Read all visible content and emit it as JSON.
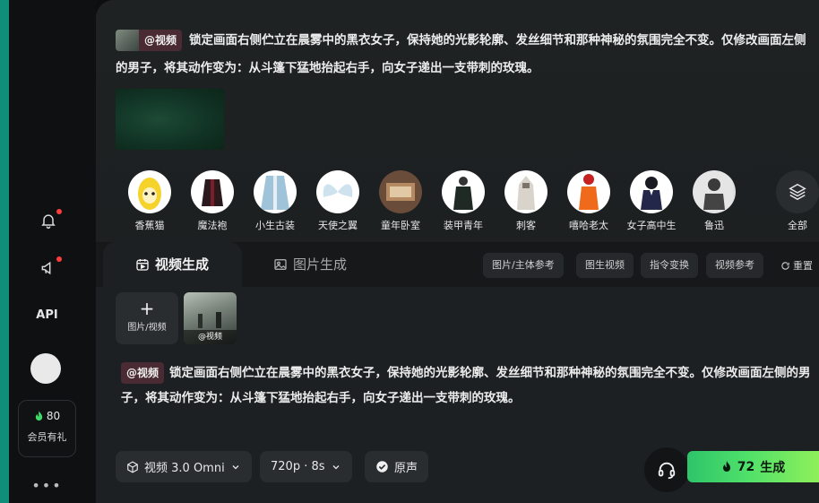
{
  "sidebar": {
    "api_label": "API",
    "vip_count": "80",
    "vip_label": "会员有礼",
    "more": "•••"
  },
  "message": {
    "tag": "@视频",
    "text_line1": "锁定画面右侧伫立在晨雾中的黑衣女子，保持她的光影轮廓、发丝细节和那种神秘的氛围完全不变。仅修改画面左侧的男子，将其动作变为：从斗篷下猛地抬起右手，向女子递出一支带刺的玫瑰。"
  },
  "templates": [
    {
      "name": "香蕉猫",
      "icon": "banana-cat-avatar"
    },
    {
      "name": "魔法袍",
      "icon": "magic-robe-avatar"
    },
    {
      "name": "小生古装",
      "icon": "ancient-costume-avatar"
    },
    {
      "name": "天使之翼",
      "icon": "angel-wings-avatar"
    },
    {
      "name": "童年卧室",
      "icon": "childhood-room-avatar"
    },
    {
      "name": "装甲青年",
      "icon": "armored-youth-avatar"
    },
    {
      "name": "刺客",
      "icon": "assassin-avatar"
    },
    {
      "name": "嘻哈老太",
      "icon": "hiphop-granny-avatar"
    },
    {
      "name": "女子高中生",
      "icon": "schoolgirl-avatar"
    },
    {
      "name": "鲁迅",
      "icon": "luxun-avatar"
    }
  ],
  "all_label": "全部",
  "composer": {
    "tabs": [
      {
        "label": "视频生成",
        "icon": "video-calendar-icon"
      },
      {
        "label": "图片生成",
        "icon": "image-icon"
      }
    ],
    "chips": [
      "图片/主体参考",
      "图生视频",
      "指令变换",
      "视频参考"
    ],
    "reset_label": "重置",
    "upload_label": "图片/视频",
    "upload_plus": "+",
    "ref_caption": "@视频",
    "prompt_tag": "@视频",
    "prompt_text": "锁定画面右侧伫立在晨雾中的黑衣女子，保持她的光影轮廓、发丝细节和那种神秘的氛围完全不变。仅修改画面左侧的男子，将其动作变为：从斗篷下猛地抬起右手，向女子递出一支带刺的玫瑰。",
    "model_label": "视频 3.0 Omni",
    "resolution_label": "720p · 8s",
    "audio_label": "原声",
    "generate_cost": "72",
    "generate_label": "生成"
  },
  "colors": {
    "accent_edge": "#0f8f7a",
    "generate_start": "#2ec46a",
    "generate_end": "#8ef05a",
    "tag_bg": "#4a2a33",
    "notification_dot": "#ff3b3b"
  }
}
